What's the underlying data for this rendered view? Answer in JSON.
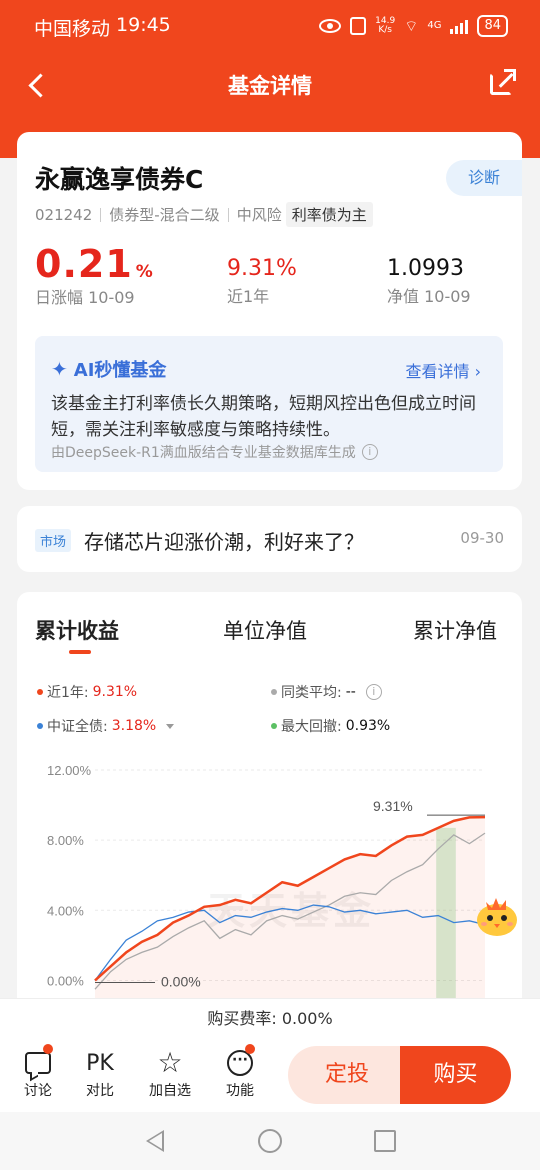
{
  "status_bar": {
    "carrier": "中国移动",
    "time": "19:45",
    "speed_value": "14.9",
    "speed_unit": "K/s",
    "network": "4G",
    "battery": "84"
  },
  "header": {
    "title": "基金详情"
  },
  "fund": {
    "name": "永赢逸享债券C",
    "code": "021242",
    "type": "债券型-混合二级",
    "risk": "中风险",
    "focus_tag": "利率债为主",
    "diagnose_label": "诊断",
    "daily_change": "0.21",
    "daily_change_unit": "%",
    "daily_change_label": "日涨幅 10-09",
    "one_year_return": "9.31%",
    "one_year_label": "近1年",
    "nav": "1.0993",
    "nav_label": "净值 10-09"
  },
  "ai_summary": {
    "title": "AI秒懂基金",
    "more_label": "查看详情",
    "text": "该基金主打利率债长久期策略，短期风控出色但成立时间短，需关注利率敏感度与策略持续性。",
    "source_note": "由DeepSeek-R1满血版结合专业基金数据库生成"
  },
  "news": {
    "tag": "市场",
    "title": "存储芯片迎涨价潮，利好来了？",
    "date": "09-30"
  },
  "chart_tabs": [
    {
      "label": "累计收益",
      "active": true
    },
    {
      "label": "单位净值",
      "active": false
    },
    {
      "label": "累计净值",
      "active": false
    }
  ],
  "legend": {
    "fund_label": "近1年:",
    "fund_value": "9.31%",
    "peer_label": "同类平均:",
    "peer_value": "--",
    "index_label": "中证全债:",
    "index_value": "3.18%",
    "drawdown_label": "最大回撤:",
    "drawdown_value": "0.93%"
  },
  "watermark": "天天基金",
  "chart_data": {
    "type": "line",
    "yticks": [
      "12.00%",
      "8.00%",
      "4.00%",
      "0.00%"
    ],
    "ylim": [
      -1,
      12
    ],
    "annotations": {
      "end_label": "9.31%",
      "start_label": "0.00%"
    },
    "series": [
      {
        "name": "近1年",
        "color": "#f0461d",
        "values": [
          0.0,
          0.8,
          1.6,
          2.2,
          2.6,
          3.3,
          3.7,
          4.2,
          4.3,
          4.6,
          4.4,
          5.0,
          5.6,
          5.4,
          5.9,
          6.4,
          6.9,
          7.2,
          7.1,
          7.7,
          8.2,
          8.3,
          8.7,
          9.1,
          9.3,
          9.31
        ]
      },
      {
        "name": "同类平均",
        "color": "#aaaaaa",
        "values": [
          -0.5,
          0.5,
          1.2,
          1.6,
          1.9,
          2.5,
          3.0,
          3.4,
          2.4,
          2.9,
          2.6,
          3.4,
          3.7,
          3.5,
          3.9,
          4.3,
          4.8,
          5.0,
          4.9,
          5.7,
          6.2,
          6.6,
          7.5,
          8.3,
          7.8,
          8.4
        ]
      },
      {
        "name": "中证全债",
        "color": "#3b82d6",
        "values": [
          0.0,
          1.2,
          2.3,
          2.8,
          3.4,
          3.6,
          3.9,
          4.0,
          3.3,
          3.7,
          3.6,
          3.9,
          4.1,
          4.0,
          4.3,
          4.2,
          3.9,
          4.0,
          3.8,
          3.9,
          4.0,
          3.6,
          3.7,
          3.3,
          3.4,
          3.18
        ]
      }
    ],
    "drawdown_highlight_index": [
      22,
      23
    ]
  },
  "fee": {
    "label": "购买费率:",
    "value": "0.00%"
  },
  "actions": [
    {
      "label": "讨论",
      "icon": "chat-icon"
    },
    {
      "label": "对比",
      "icon": "pk-icon"
    },
    {
      "label": "加自选",
      "icon": "star-icon"
    },
    {
      "label": "功能",
      "icon": "more-icon"
    }
  ],
  "buttons": {
    "invest": "定投",
    "buy": "购买"
  },
  "colors": {
    "brand": "#f0461d",
    "rise": "#e5261c",
    "ai_blue": "#3a6fd8"
  }
}
